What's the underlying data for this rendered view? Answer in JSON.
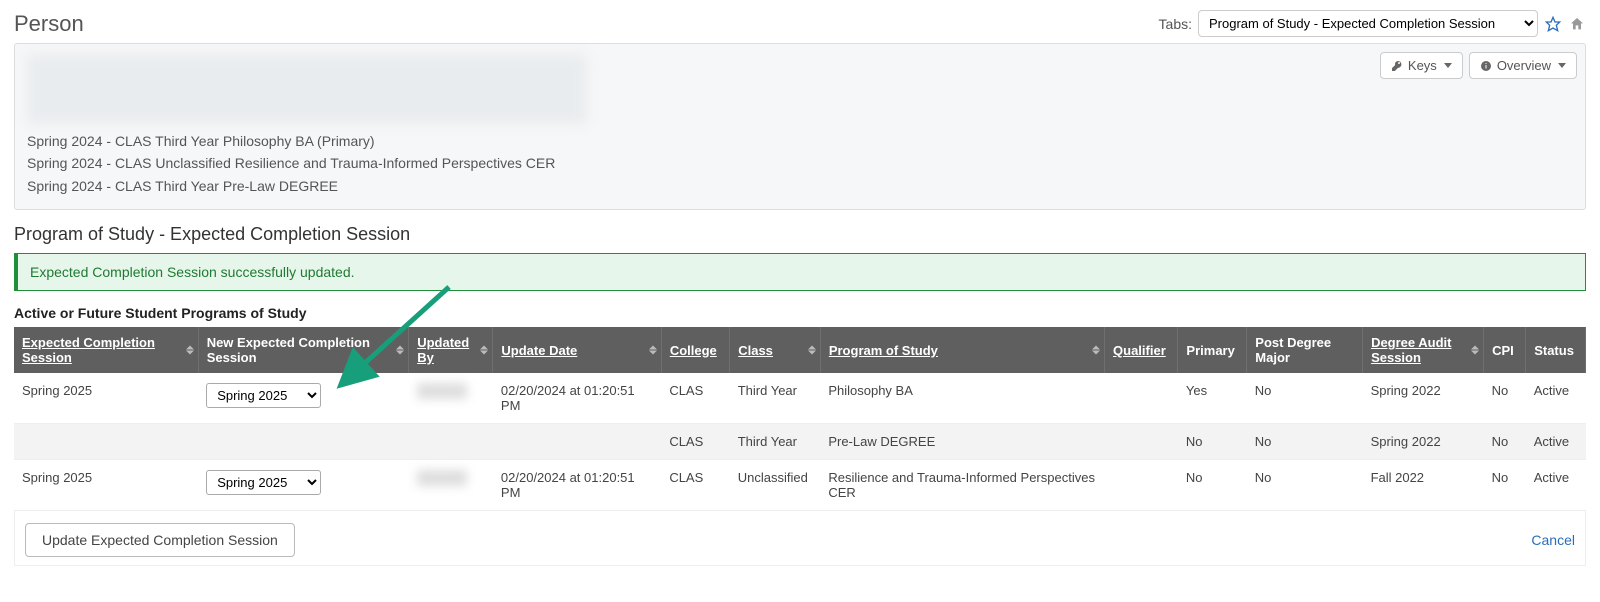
{
  "header": {
    "title": "Person",
    "tabs_label": "Tabs:",
    "tabs_selected": "Program of Study - Expected Completion Session"
  },
  "panel": {
    "keys_btn": "Keys",
    "overview_btn": "Overview",
    "programs": [
      "Spring 2024 - CLAS Third Year Philosophy BA (Primary)",
      "Spring 2024 - CLAS Unclassified Resilience and Trauma-Informed Perspectives CER",
      "Spring 2024 - CLAS Third Year Pre-Law DEGREE"
    ]
  },
  "section": {
    "title": "Program of Study - Expected Completion Session",
    "success_msg": "Expected Completion Session successfully updated.",
    "subtitle": "Active or Future Student Programs of Study"
  },
  "table": {
    "headers": {
      "ecs": "Expected Completion Session",
      "new_ecs": "New Expected Completion Session",
      "updated_by": "Updated By",
      "update_date": "Update Date",
      "college": "College",
      "class": "Class",
      "pos": "Program of Study",
      "qualifier": "Qualifier",
      "primary": "Primary",
      "post_degree": "Post Degree Major",
      "degree_audit": "Degree Audit Session",
      "cpi": "CPI",
      "status": "Status"
    },
    "rows": [
      {
        "ecs": "Spring 2025",
        "new_ecs": "Spring 2025",
        "update_date": "02/20/2024 at 01:20:51 PM",
        "college": "CLAS",
        "class": "Third Year",
        "pos": "Philosophy BA",
        "qualifier": "",
        "primary": "Yes",
        "post_degree": "No",
        "degree_audit": "Spring 2022",
        "cpi": "No",
        "status": "Active"
      },
      {
        "ecs": "",
        "new_ecs": "",
        "update_date": "",
        "college": "CLAS",
        "class": "Third Year",
        "pos": "Pre-Law DEGREE",
        "qualifier": "",
        "primary": "No",
        "post_degree": "No",
        "degree_audit": "Spring 2022",
        "cpi": "No",
        "status": "Active"
      },
      {
        "ecs": "Spring 2025",
        "new_ecs": "Spring 2025",
        "update_date": "02/20/2024 at 01:20:51 PM",
        "college": "CLAS",
        "class": "Unclassified",
        "pos": "Resilience and Trauma-Informed Perspectives CER",
        "qualifier": "",
        "primary": "No",
        "post_degree": "No",
        "degree_audit": "Fall 2022",
        "cpi": "No",
        "status": "Active"
      }
    ]
  },
  "footer": {
    "update_btn": "Update Expected Completion Session",
    "cancel": "Cancel"
  }
}
